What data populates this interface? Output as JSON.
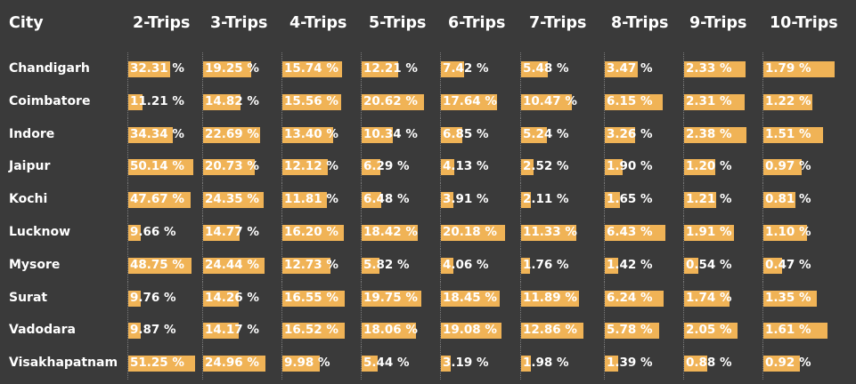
{
  "table": {
    "bar_color": "#f0b356",
    "header": {
      "city": "City",
      "columns": [
        "2-Trips",
        "3-Trips",
        "4-Trips",
        "5-Trips",
        "6-Trips",
        "7-Trips",
        "8-Trips",
        "9-Trips",
        "10-Trips"
      ]
    },
    "rows": [
      {
        "city": "Chandigarh",
        "values": [
          "32.31 %",
          "19.25 %",
          "15.74 %",
          "12.21 %",
          "7.42 %",
          "5.48 %",
          "3.47 %",
          "2.33 %",
          "1.79 %"
        ]
      },
      {
        "city": "Coimbatore",
        "values": [
          "11.21 %",
          "14.82 %",
          "15.56 %",
          "20.62 %",
          "17.64 %",
          "10.47 %",
          "6.15 %",
          "2.31 %",
          "1.22 %"
        ]
      },
      {
        "city": "Indore",
        "values": [
          "34.34 %",
          "22.69 %",
          "13.40 %",
          "10.34 %",
          "6.85 %",
          "5.24 %",
          "3.26 %",
          "2.38 %",
          "1.51 %"
        ]
      },
      {
        "city": "Jaipur",
        "values": [
          "50.14 %",
          "20.73 %",
          "12.12 %",
          "6.29 %",
          "4.13 %",
          "2.52 %",
          "1.90 %",
          "1.20 %",
          "0.97 %"
        ]
      },
      {
        "city": "Kochi",
        "values": [
          "47.67 %",
          "24.35 %",
          "11.81 %",
          "6.48 %",
          "3.91 %",
          "2.11 %",
          "1.65 %",
          "1.21 %",
          "0.81 %"
        ]
      },
      {
        "city": "Lucknow",
        "values": [
          "9.66 %",
          "14.77 %",
          "16.20 %",
          "18.42 %",
          "20.18 %",
          "11.33 %",
          "6.43 %",
          "1.91 %",
          "1.10 %"
        ]
      },
      {
        "city": "Mysore",
        "values": [
          "48.75 %",
          "24.44 %",
          "12.73 %",
          "5.82 %",
          "4.06 %",
          "1.76 %",
          "1.42 %",
          "0.54 %",
          "0.47 %"
        ]
      },
      {
        "city": "Surat",
        "values": [
          "9.76 %",
          "14.26 %",
          "16.55 %",
          "19.75 %",
          "18.45 %",
          "11.89 %",
          "6.24 %",
          "1.74 %",
          "1.35 %"
        ]
      },
      {
        "city": "Vadodara",
        "values": [
          "9.87 %",
          "14.17 %",
          "16.52 %",
          "18.06 %",
          "19.08 %",
          "12.86 %",
          "5.78 %",
          "2.05 %",
          "1.61 %"
        ]
      },
      {
        "city": "Visakhapatnam",
        "values": [
          "51.25 %",
          "24.96 %",
          "9.98 %",
          "5.44 %",
          "3.19 %",
          "1.98 %",
          "1.39 %",
          "0.88 %",
          "0.92 %"
        ]
      }
    ]
  }
}
